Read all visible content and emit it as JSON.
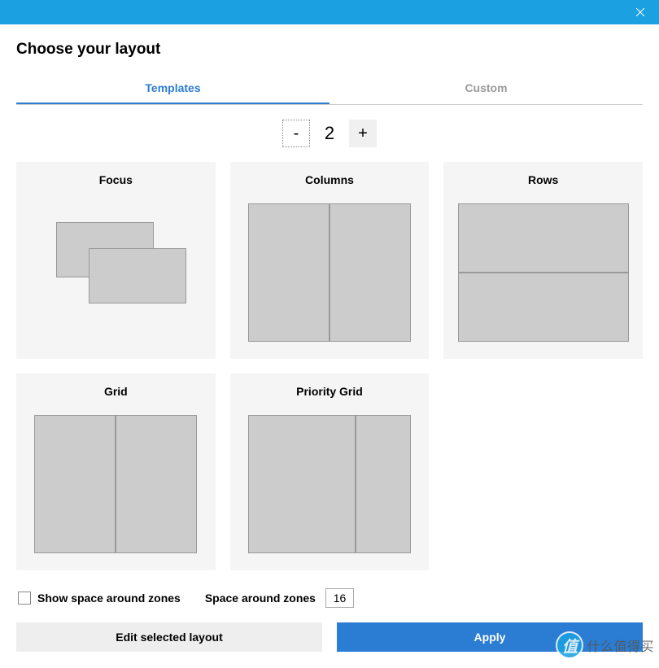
{
  "header": {
    "title": "Choose your layout"
  },
  "tabs": {
    "templates": "Templates",
    "custom": "Custom"
  },
  "counter": {
    "value": "2",
    "minus": "-",
    "plus": "+"
  },
  "templates": {
    "focus": "Focus",
    "columns": "Columns",
    "rows": "Rows",
    "grid": "Grid",
    "priority_grid": "Priority Grid"
  },
  "options": {
    "show_space_label": "Show space around zones",
    "space_label": "Space around zones",
    "space_value": "16"
  },
  "buttons": {
    "edit": "Edit selected layout",
    "apply": "Apply"
  },
  "watermark": {
    "badge": "值",
    "text": "什么值得买"
  }
}
